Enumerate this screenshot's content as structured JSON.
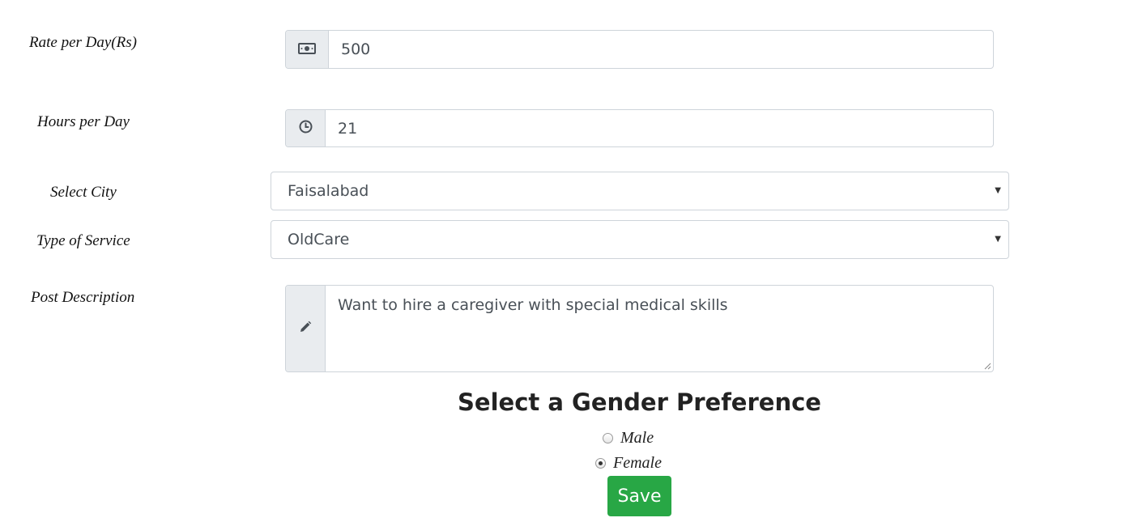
{
  "form": {
    "rate": {
      "label": "Rate per Day(Rs)",
      "value": "500",
      "icon": "money-icon"
    },
    "hours": {
      "label": "Hours per Day",
      "value": "21",
      "icon": "clock-icon"
    },
    "city": {
      "label": "Select City",
      "value": "Faisalabad"
    },
    "service": {
      "label": "Type of Service",
      "value": "OldCare"
    },
    "description": {
      "label": "Post Description",
      "value": "Want to hire a caregiver with special medical skills",
      "icon": "pencil-icon"
    }
  },
  "gender": {
    "heading": "Select a Gender Preference",
    "options": [
      {
        "label": "Male",
        "checked": false
      },
      {
        "label": "Female",
        "checked": true
      }
    ]
  },
  "save_label": "Save",
  "colors": {
    "save_button": "#28a745",
    "addon_bg": "#e9ecef",
    "border": "#ced4da"
  }
}
